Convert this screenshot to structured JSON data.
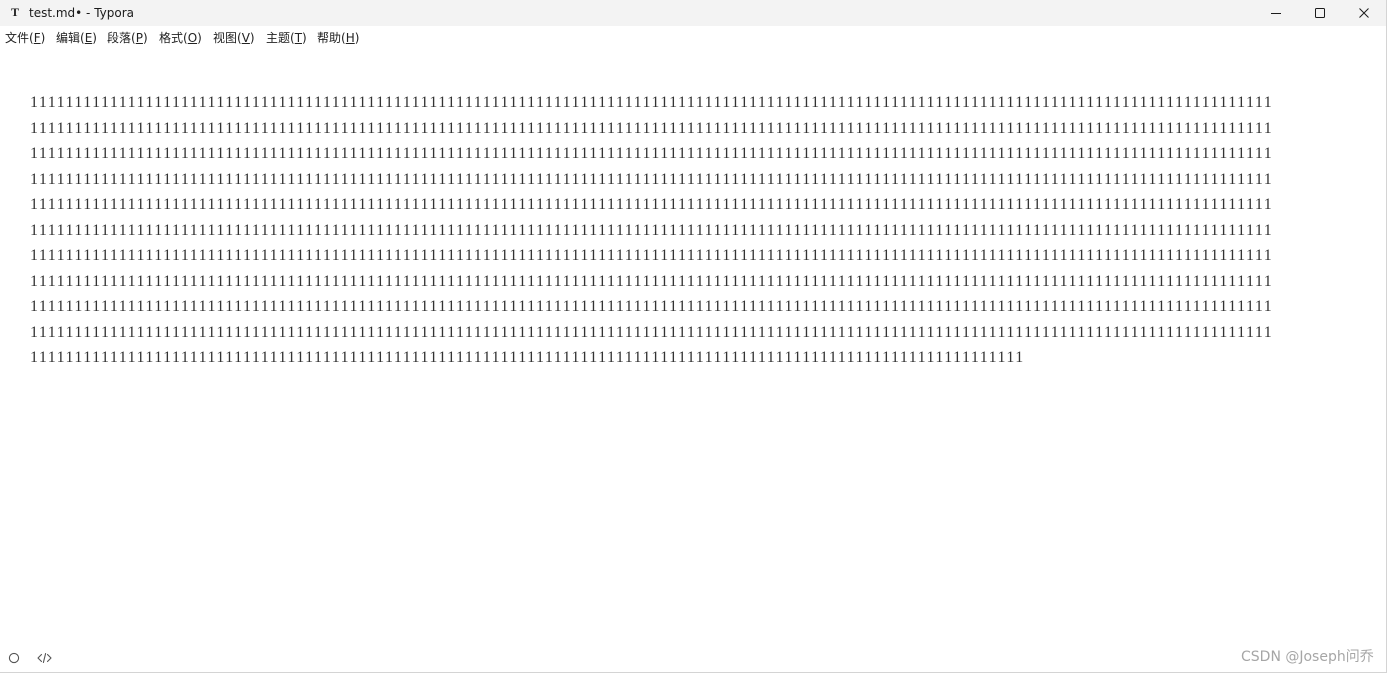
{
  "window": {
    "app_icon_letter": "T",
    "title": "test.md• - Typora",
    "controls": {
      "minimize": "minimize-icon",
      "maximize": "maximize-icon",
      "close": "close-icon"
    }
  },
  "menu": {
    "items": [
      {
        "label": "文件(F)"
      },
      {
        "label": "编辑(E)"
      },
      {
        "label": "段落(P)"
      },
      {
        "label": "格式(O)"
      },
      {
        "label": "视图(V)"
      },
      {
        "label": "主题(T)"
      },
      {
        "label": "帮助(H)"
      }
    ]
  },
  "document": {
    "lines": [
      "11111111111111111111111111111111111111111111111111111111111111111111111111111111111111111111111111111111111111111111111111111111111111111111",
      "11111111111111111111111111111111111111111111111111111111111111111111111111111111111111111111111111111111111111111111111111111111111111111111",
      "11111111111111111111111111111111111111111111111111111111111111111111111111111111111111111111111111111111111111111111111111111111111111111111",
      "11111111111111111111111111111111111111111111111111111111111111111111111111111111111111111111111111111111111111111111111111111111111111111111",
      "11111111111111111111111111111111111111111111111111111111111111111111111111111111111111111111111111111111111111111111111111111111111111111111",
      "11111111111111111111111111111111111111111111111111111111111111111111111111111111111111111111111111111111111111111111111111111111111111111111",
      "11111111111111111111111111111111111111111111111111111111111111111111111111111111111111111111111111111111111111111111111111111111111111111111",
      "11111111111111111111111111111111111111111111111111111111111111111111111111111111111111111111111111111111111111111111111111111111111111111111",
      "11111111111111111111111111111111111111111111111111111111111111111111111111111111111111111111111111111111111111111111111111111111111111111111",
      "11111111111111111111111111111111111111111111111111111111111111111111111111111111111111111111111111111111111111111111111111111111111111111111",
      "1111111111111111111111111111111111111111111111111111111111111111111111111111111111111111111111111111111111111111"
    ]
  },
  "status_bar": {
    "icons": [
      "outline-toggle-icon",
      "source-code-icon"
    ]
  },
  "watermark": "CSDN @Joseph问乔",
  "colors": {
    "titlebar_bg": "#f3f3f3",
    "text": "#333333",
    "watermark": "#a6a6a6"
  }
}
